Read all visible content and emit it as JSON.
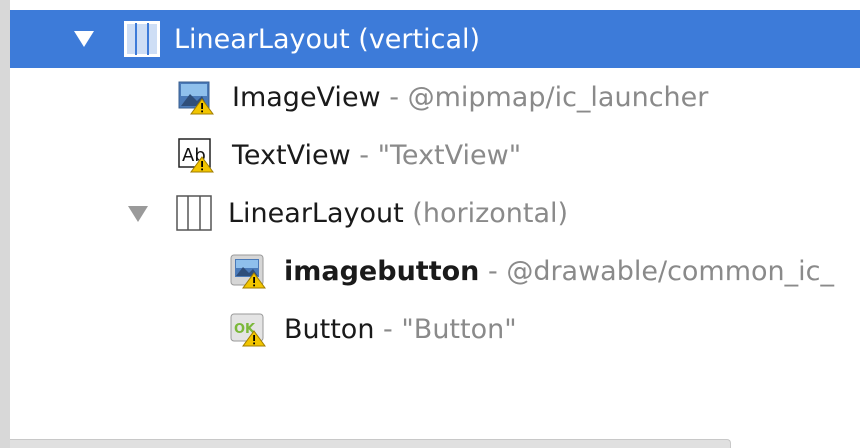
{
  "tree": {
    "items": [
      {
        "name": "LinearLayout",
        "separator": " ",
        "detail": "(vertical)",
        "icon": "vertical-layout-icon",
        "expanded": true,
        "selected": true
      },
      {
        "name": "ImageView",
        "separator": " - ",
        "detail": "@mipmap/ic_launcher",
        "icon": "image-view-warning-icon"
      },
      {
        "name": "TextView",
        "separator": " - ",
        "detail": "\"TextView\"",
        "icon": "text-view-warning-icon"
      },
      {
        "name": "LinearLayout",
        "separator": " ",
        "detail": "(horizontal)",
        "icon": "horizontal-layout-icon",
        "expanded": true
      },
      {
        "name": "imagebutton",
        "separator": " - ",
        "detail": "@drawable/common_ic_",
        "icon": "image-button-warning-icon",
        "bold": true
      },
      {
        "name": "Button",
        "separator": " - ",
        "detail": "\"Button\"",
        "icon": "button-warning-icon"
      }
    ]
  },
  "colors": {
    "selection": "#3d7bd9",
    "secondary_text": "#8a8a8a",
    "warning": "#f2c500"
  }
}
